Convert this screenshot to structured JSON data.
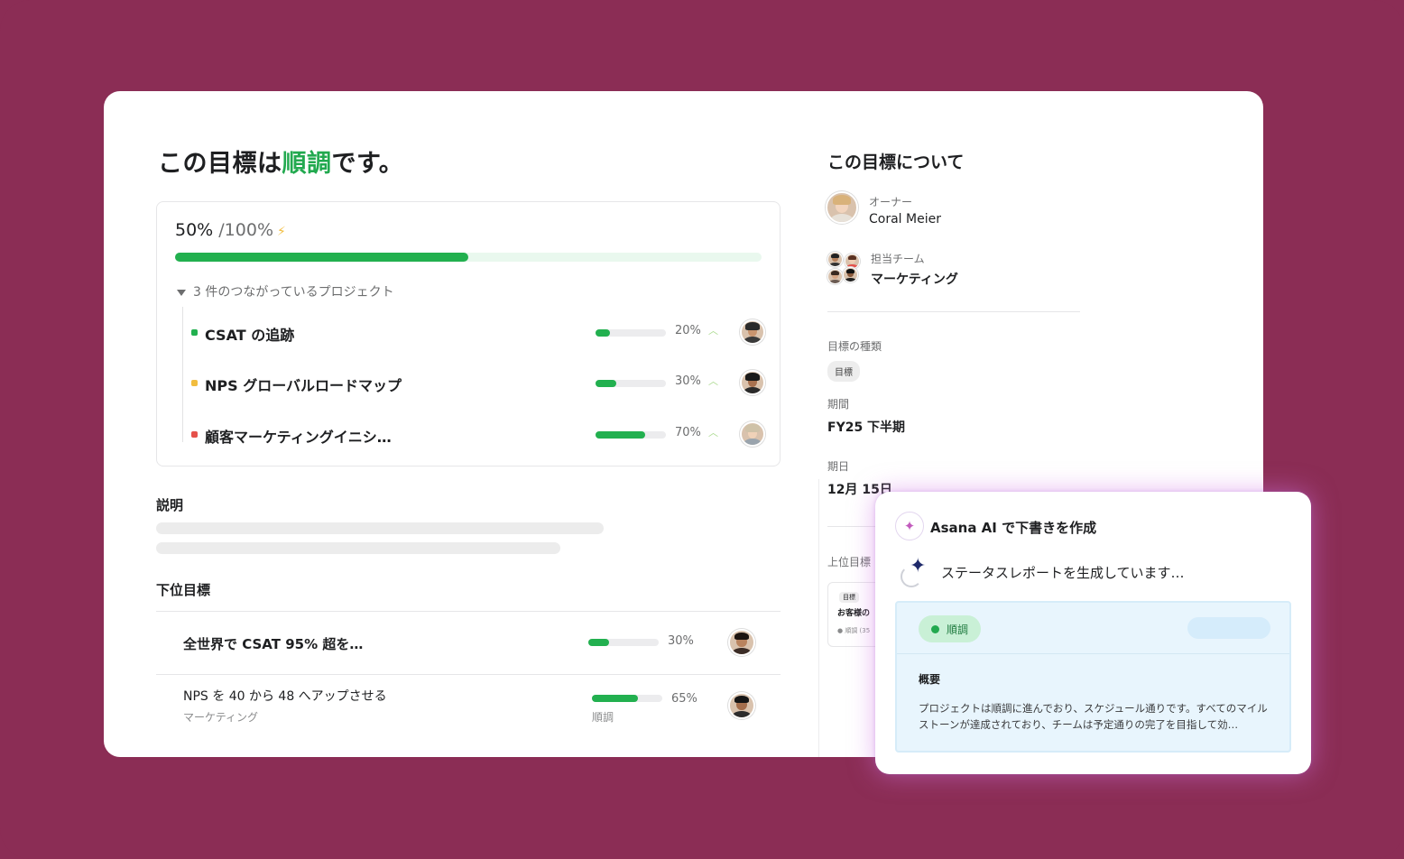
{
  "goal": {
    "headline_prefix": "この目標は",
    "headline_status": "順調",
    "headline_suffix": "です。",
    "progress_value": "50%",
    "progress_total": " /100%",
    "progress_fraction": 0.5,
    "linked_projects_label": "3 件のつながっているプロジェクト",
    "projects": [
      {
        "name": "CSAT の追跡",
        "percent": "20%",
        "progress": 0.2,
        "color": "#22b04f"
      },
      {
        "name": "NPS グローバルロードマップ",
        "percent": "30%",
        "progress": 0.3,
        "color": "#f1bd3f"
      },
      {
        "name": "顧客マーケティングイニシ…",
        "percent": "70%",
        "progress": 0.7,
        "color": "#e5514b"
      }
    ]
  },
  "description": {
    "label": "説明"
  },
  "subgoals": {
    "label": "下位目標",
    "items": [
      {
        "name": "全世界で CSAT 95% 超を…",
        "owner": "",
        "status": "",
        "percent": "30%",
        "progress": 0.3
      },
      {
        "name": "NPS を 40 から 48 へアップさせる",
        "owner": "マーケティング",
        "status": "順調",
        "percent": "65%",
        "progress": 0.65
      }
    ]
  },
  "about": {
    "title": "この目標について",
    "owner_label": "オーナー",
    "owner_name": "Coral Meier",
    "team_label": "担当チーム",
    "team_name": "マーケティング",
    "type_label": "目標の種類",
    "type_value": "目標",
    "period_label": "期間",
    "period_value": "FY25 下半期",
    "due_label": "期日",
    "due_value": "12月 15日",
    "parent_label": "上位目標",
    "parent_card": {
      "tag": "目標",
      "name": "お客様の",
      "status": "● 順調 (35"
    }
  },
  "ai_popup": {
    "title": "Asana AI で下書きを作成",
    "status_text": "ステータスレポートを生成しています…",
    "pill_label": "順調",
    "summary_label": "概要",
    "summary_text": "プロジェクトは順調に進んでおり、スケジュール通りです。すべてのマイルストーンが達成されており、チームは予定通りの完了を目指して効…"
  },
  "colors": {
    "background": "#8b2d55",
    "on_track": "#22a94f",
    "progress_fill": "#22b04f"
  }
}
